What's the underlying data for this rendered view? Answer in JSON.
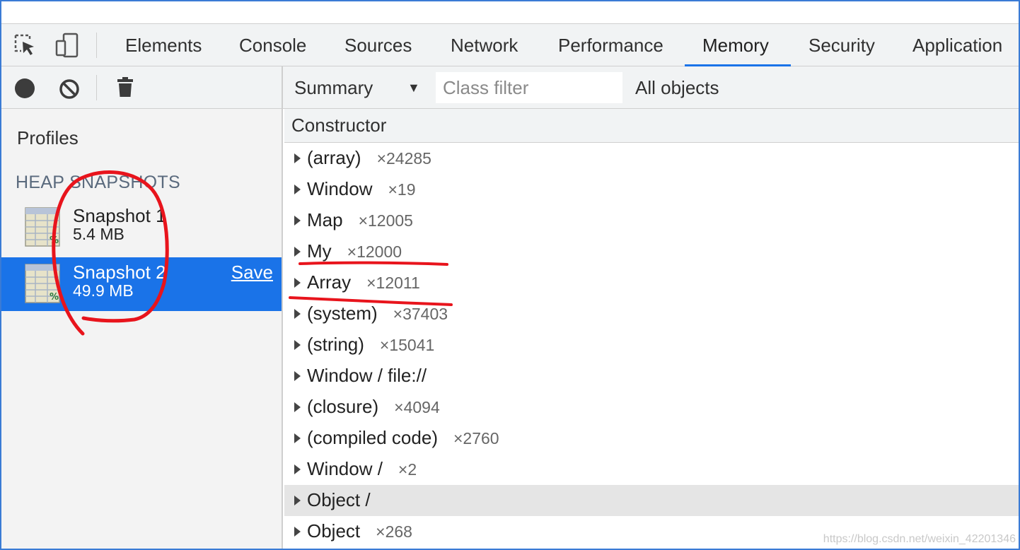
{
  "devtools": {
    "tabs": [
      {
        "label": "Elements"
      },
      {
        "label": "Console"
      },
      {
        "label": "Sources"
      },
      {
        "label": "Network"
      },
      {
        "label": "Performance"
      },
      {
        "label": "Memory"
      },
      {
        "label": "Security"
      },
      {
        "label": "Application"
      }
    ],
    "active_tab": "Memory",
    "accent_color": "#1a73e8"
  },
  "toolbar": {
    "view_select": "Summary",
    "class_filter_placeholder": "Class filter",
    "objects_filter": "All objects"
  },
  "sidebar": {
    "profiles_title": "Profiles",
    "section_title": "HEAP SNAPSHOTS",
    "snapshots": [
      {
        "name": "Snapshot 1",
        "size": "5.4 MB"
      },
      {
        "name": "Snapshot 2",
        "size": "49.9 MB",
        "save_label": "Save"
      }
    ]
  },
  "table": {
    "header": "Constructor",
    "rows": [
      {
        "name": "(array)",
        "count": "×24285"
      },
      {
        "name": "Window",
        "count": "×19"
      },
      {
        "name": "Map",
        "count": "×12005"
      },
      {
        "name": "My",
        "count": "×12000"
      },
      {
        "name": "Array",
        "count": "×12011"
      },
      {
        "name": "(system)",
        "count": "×37403"
      },
      {
        "name": "(string)",
        "count": "×15041"
      },
      {
        "name": "Window / file://",
        "count": ""
      },
      {
        "name": "(closure)",
        "count": "×4094"
      },
      {
        "name": "(compiled code)",
        "count": "×2760"
      },
      {
        "name": "Window /",
        "count": "×2"
      },
      {
        "name": "Object /",
        "count": ""
      },
      {
        "name": "Object",
        "count": "×268"
      }
    ]
  },
  "watermark": "https://blog.csdn.net/weixin_42201346",
  "annotation_color": "#e8141c"
}
